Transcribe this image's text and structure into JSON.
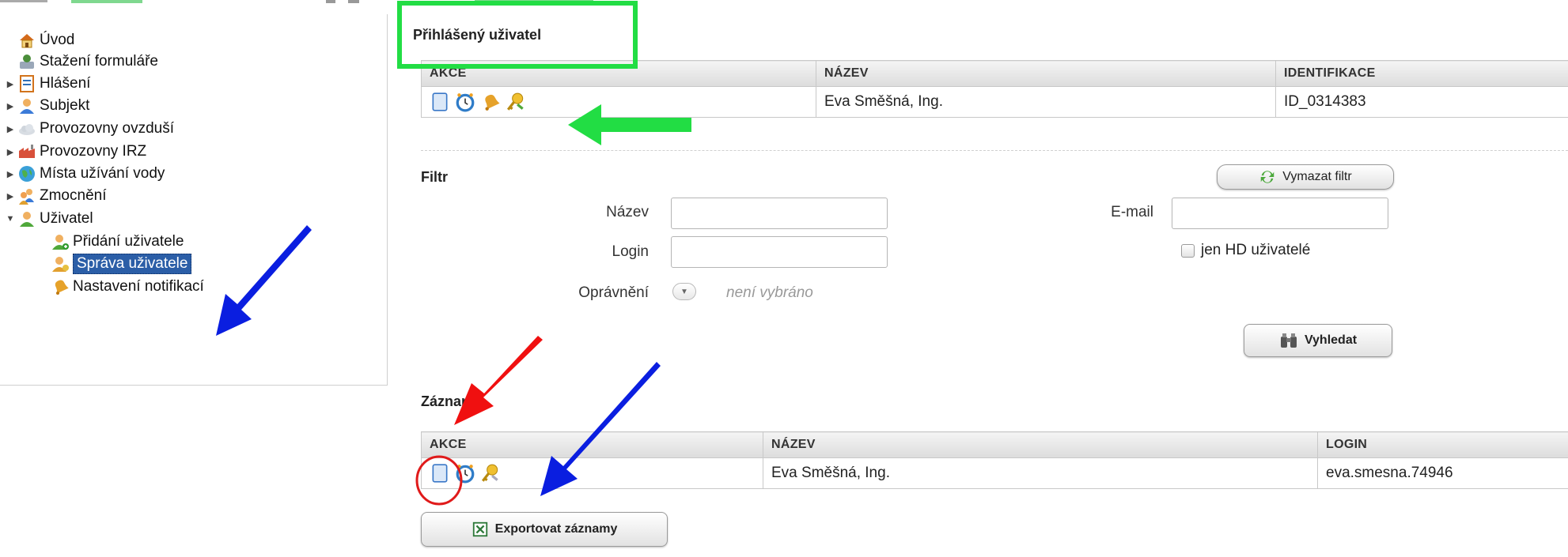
{
  "sidebar": {
    "items": [
      {
        "label": "Úvod",
        "icon": "home-icon",
        "toggle": ""
      },
      {
        "label": "Stažení formuláře",
        "icon": "download-form-icon",
        "toggle": ""
      },
      {
        "label": "Hlášení",
        "icon": "report-icon",
        "toggle": "▶"
      },
      {
        "label": "Subjekt",
        "icon": "subject-icon",
        "toggle": "▶"
      },
      {
        "label": "Provozovny ovzduší",
        "icon": "cloud-icon",
        "toggle": "▶"
      },
      {
        "label": "Provozovny IRZ",
        "icon": "factory-icon",
        "toggle": "▶"
      },
      {
        "label": "Místa užívání vody",
        "icon": "globe-icon",
        "toggle": "▶"
      },
      {
        "label": "Zmocnění",
        "icon": "users-icon",
        "toggle": "▶"
      },
      {
        "label": "Uživatel",
        "icon": "user-icon",
        "toggle": "▼"
      },
      {
        "label": "Přidání uživatele",
        "icon": "add-user-icon",
        "toggle": ""
      },
      {
        "label": "Správa uživatele",
        "icon": "manage-user-icon",
        "toggle": ""
      },
      {
        "label": "Nastavení notifikací",
        "icon": "bell-icon",
        "toggle": ""
      }
    ]
  },
  "logged_user": {
    "title": "Přihlášený uživatel",
    "columns": [
      "AKCE",
      "NÁZEV",
      "IDENTIFIKACE"
    ],
    "row": {
      "name": "Eva Směšná, Ing.",
      "id": "ID_0314383"
    },
    "action_icons": [
      "document-icon",
      "clock-icon",
      "bell-icon",
      "key-icon"
    ]
  },
  "filter": {
    "title": "Filtr",
    "clear_button": "Vymazat filtr",
    "name_label": "Název",
    "login_label": "Login",
    "email_label": "E-mail",
    "hd_checkbox_label": "jen HD uživatelé",
    "permission_label": "Oprávnění",
    "permission_value": "není vybráno",
    "search_button": "Vyhledat"
  },
  "records": {
    "title": "Záznamy",
    "columns": [
      "AKCE",
      "NÁZEV",
      "LOGIN"
    ],
    "row": {
      "name": "Eva Směšná, Ing.",
      "login": "eva.smesna.74946"
    },
    "action_icons": [
      "document-icon",
      "clock-icon",
      "key-icon"
    ],
    "export_button": "Exportovat záznamy"
  },
  "colors": {
    "highlight_green": "#22dd44",
    "arrow_blue": "#0a1ee0",
    "arrow_red": "#f01010",
    "selected_bg": "#2b5ea7"
  }
}
